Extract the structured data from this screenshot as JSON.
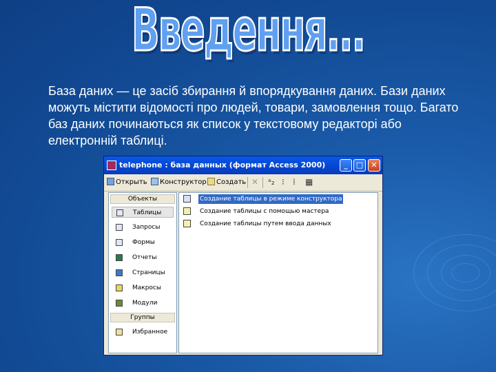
{
  "slide": {
    "title": "Введення...",
    "body": "База даних — це засіб збирання й впорядкування даних. Бази даних можуть містити відомості про людей, товари, замовлення тощо. Багато баз даних починаються як список у текстовому редакторі або електронній таблиці."
  },
  "window": {
    "title": "telephone : база данных (формат Access 2000)",
    "buttons": {
      "minimize": "_",
      "maximize": "□",
      "close": "✕"
    },
    "toolbar": {
      "open": "Открыть",
      "design": "Конструктор",
      "create": "Создать",
      "delete_glyph": "✕",
      "view_glyphs": [
        "ᵃ₂",
        "⁝",
        "⁞",
        "▦"
      ]
    },
    "sidebar": {
      "objects_header": "Объекты",
      "items": [
        {
          "label": "Таблицы",
          "icon": "table-icon"
        },
        {
          "label": "Запросы",
          "icon": "query-icon"
        },
        {
          "label": "Формы",
          "icon": "form-icon"
        },
        {
          "label": "Отчеты",
          "icon": "report-icon"
        },
        {
          "label": "Страницы",
          "icon": "page-icon"
        },
        {
          "label": "Макросы",
          "icon": "macro-icon"
        },
        {
          "label": "Модули",
          "icon": "module-icon"
        }
      ],
      "groups_header": "Группы",
      "group_items": [
        {
          "label": "Избранное",
          "icon": "favorites-icon"
        }
      ]
    },
    "objects": [
      {
        "label": "Создание таблицы в режиме конструктора",
        "selected": true
      },
      {
        "label": "Создание таблицы с помощью мастера",
        "selected": false
      },
      {
        "label": "Создание таблицы путем ввода данных",
        "selected": false
      }
    ]
  },
  "colors": {
    "slide_bg": "#1a5aa8",
    "title_fill": "#5fa0f0",
    "xp_titlebar": "#0346d1",
    "selection": "#316ac5"
  }
}
